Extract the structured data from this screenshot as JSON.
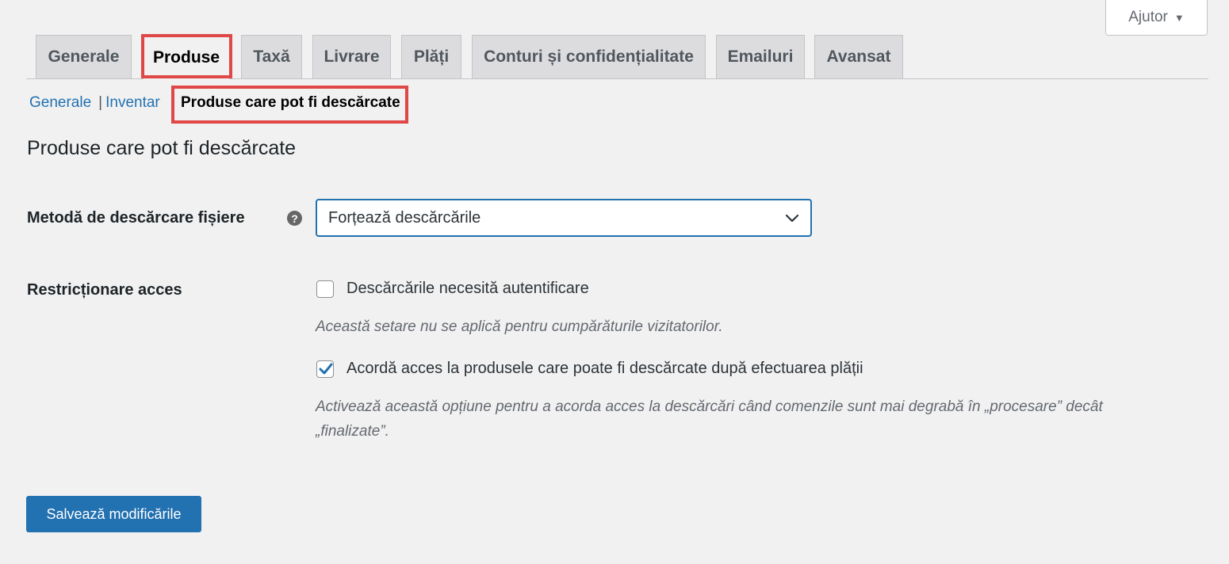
{
  "help": {
    "label": "Ajutor",
    "arrow": "▼"
  },
  "tabs": [
    {
      "label": "Generale",
      "active": false
    },
    {
      "label": "Produse",
      "active": true
    },
    {
      "label": "Taxă",
      "active": false
    },
    {
      "label": "Livrare",
      "active": false
    },
    {
      "label": "Plăți",
      "active": false
    },
    {
      "label": "Conturi și confidențialitate",
      "active": false
    },
    {
      "label": "Emailuri",
      "active": false
    },
    {
      "label": "Avansat",
      "active": false
    }
  ],
  "subnav": {
    "items": [
      {
        "label": "Generale"
      },
      {
        "label": "Inventar"
      }
    ],
    "separator": "|",
    "current": "Produse care pot fi descărcate"
  },
  "page": {
    "title": "Produse care pot fi descărcate"
  },
  "form": {
    "download_method": {
      "label": "Metodă de descărcare fișiere",
      "tip": "?",
      "selected": "Forțează descărcările"
    },
    "access": {
      "label": "Restricționare acces",
      "require_login": {
        "label": "Descărcările necesită autentificare",
        "checked": false,
        "description": "Această setare nu se aplică pentru cumpărăturile vizitatorilor."
      },
      "grant_after_payment": {
        "label": "Acordă acces la produsele care poate fi descărcate după efectuarea plății",
        "checked": true,
        "description_line1": "Activează această opțiune pentru a acorda acces la descărcări când comenzile sunt mai degrabă în „procesare” decât",
        "description_line2": "„finalizate”."
      }
    }
  },
  "actions": {
    "save_label": "Salvează modificările"
  },
  "colors": {
    "accent": "#2271b1",
    "highlight": "#e04848",
    "background": "#f1f1f1"
  }
}
